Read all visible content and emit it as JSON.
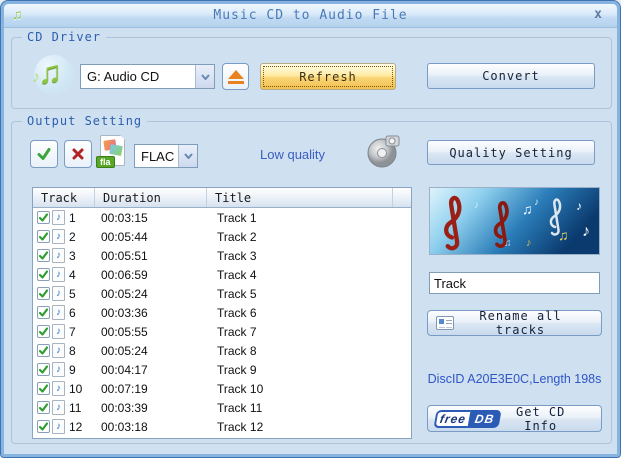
{
  "window": {
    "title": "Music CD to Audio File",
    "close_glyph": "x"
  },
  "icons": {
    "note": "♪",
    "beamed_note": "♫"
  },
  "cd_driver": {
    "label": "CD Driver",
    "drive_selected": "G: Audio CD",
    "refresh_label": "Refresh",
    "convert_label": "Convert"
  },
  "output_setting": {
    "label": "Output Setting",
    "format_selected": "FLAC",
    "format_badge": "fla",
    "quality_text": "Low quality",
    "quality_button_label": "Quality Setting"
  },
  "track_table": {
    "headers": [
      "Track",
      "Duration",
      "Title"
    ],
    "rows": [
      {
        "num": "1",
        "duration": "00:03:15",
        "title": "Track 1"
      },
      {
        "num": "2",
        "duration": "00:05:44",
        "title": "Track 2"
      },
      {
        "num": "3",
        "duration": "00:05:51",
        "title": "Track 3"
      },
      {
        "num": "4",
        "duration": "00:06:59",
        "title": "Track 4"
      },
      {
        "num": "5",
        "duration": "00:05:24",
        "title": "Track 5"
      },
      {
        "num": "6",
        "duration": "00:03:36",
        "title": "Track 6"
      },
      {
        "num": "7",
        "duration": "00:05:55",
        "title": "Track 7"
      },
      {
        "num": "8",
        "duration": "00:05:24",
        "title": "Track 8"
      },
      {
        "num": "9",
        "duration": "00:04:17",
        "title": "Track 9"
      },
      {
        "num": "10",
        "duration": "00:07:19",
        "title": "Track 10"
      },
      {
        "num": "11",
        "duration": "00:03:39",
        "title": "Track 11"
      },
      {
        "num": "12",
        "duration": "00:03:18",
        "title": "Track 12"
      }
    ]
  },
  "side_panel": {
    "filename_value": "Track",
    "rename_button_label": "Rename all tracks",
    "disc_info": "DiscID A20E3E0C,Length 198s",
    "freedb_free": "free",
    "freedb_db": "DB",
    "get_cd_info_label": "Get CD Info"
  },
  "colors": {
    "refresh_gold": "#f2c051",
    "accent_blue": "#2b5bb4",
    "link_blue": "#3a5fc0",
    "green_check": "#3aa53a",
    "red_cross": "#b22222",
    "note_green": "#8cc63e",
    "clef_red": "#9b1f14"
  }
}
